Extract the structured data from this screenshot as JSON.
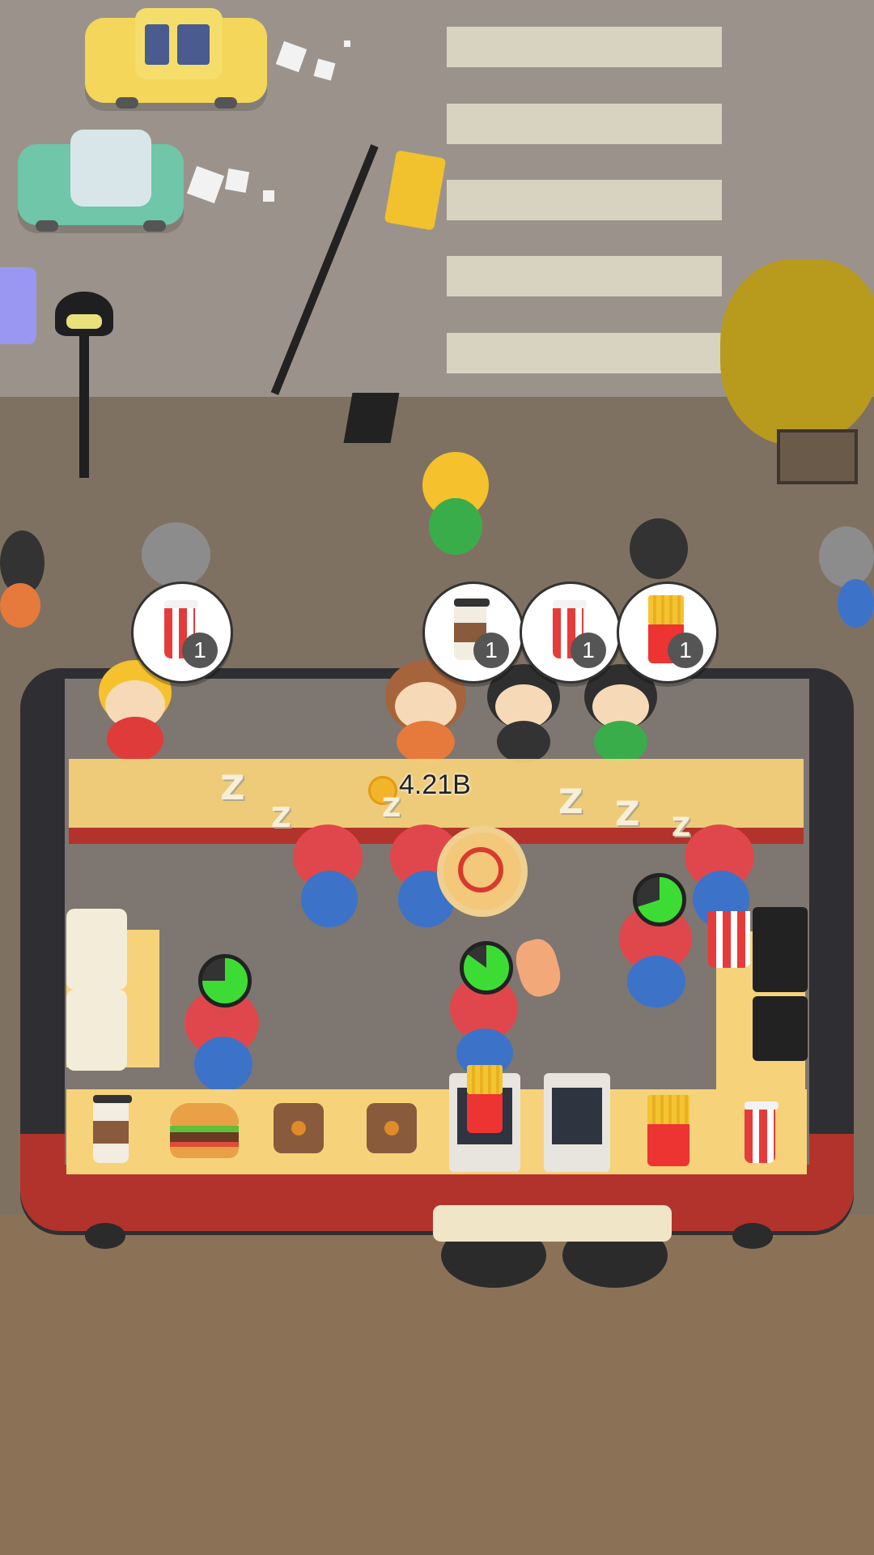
{
  "hud": {
    "money": "4.21B",
    "coin_icon": "coin-icon"
  },
  "orders": [
    {
      "item": "soda-cup-icon",
      "count": "1"
    },
    {
      "item": "coffee-cup-icon",
      "count": "1"
    },
    {
      "item": "soda-cup-icon",
      "count": "1"
    },
    {
      "item": "fries-icon",
      "count": "1"
    }
  ],
  "counter_items": [
    "coffee-cup-icon",
    "burger-icon",
    "cutting-board-icon",
    "cutting-board-icon",
    "fryer-icon",
    "fryer-icon",
    "fries-icon",
    "soda-cup-icon"
  ],
  "sleep_text": "Z",
  "colors": {
    "road": "#9b938b",
    "sidewalk": "#7f7162",
    "ground": "#8b7257",
    "counter": "#f6d37a",
    "truck_red": "#b2332c",
    "truck_frame": "#2f2f33",
    "staff_hat": "#e0474c",
    "staff_body": "#3c73c8",
    "timer_green": "#3ddc35"
  }
}
